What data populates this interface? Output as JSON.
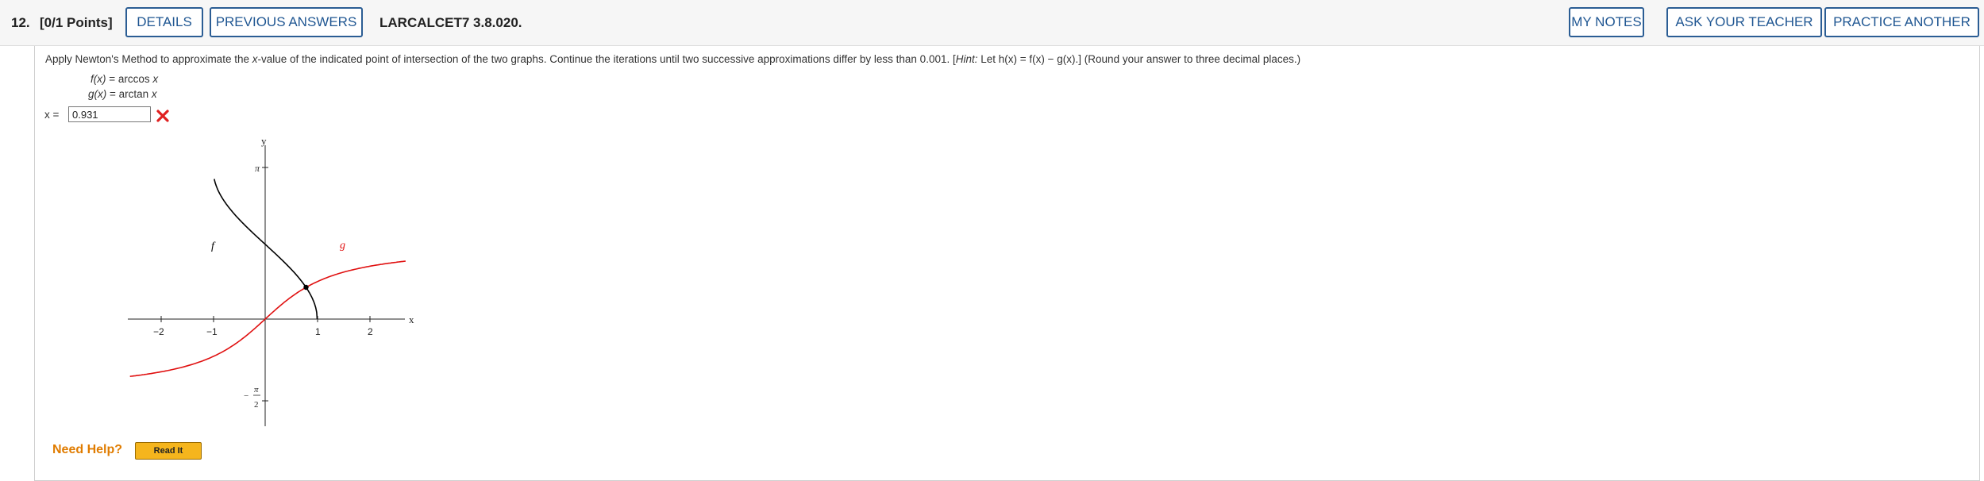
{
  "header": {
    "question_number": "12.",
    "points": "[0/1 Points]",
    "details_label": "DETAILS",
    "previous_answers_label": "PREVIOUS ANSWERS",
    "assignment_code": "LARCALCET7 3.8.020.",
    "my_notes_label": "MY NOTES",
    "ask_teacher_label": "ASK YOUR TEACHER",
    "practice_another_label": "PRACTICE ANOTHER"
  },
  "problem": {
    "text_1": "Apply Newton's Method to approximate the ",
    "var_x": "x",
    "text_2": "-value of the indicated point of intersection of the two graphs. Continue the iterations until two successive approximations differ by less than 0.001. [",
    "hint_label": "Hint:",
    "text_3": " Let ",
    "hint_formula": "h(x) = f(x) − g(x).",
    "text_4": "] (Round your answer to three decimal places.)",
    "f_lhs": "f(x)",
    "f_rhs": " = arccos ",
    "f_arg": "x",
    "g_lhs": "g(x)",
    "g_rhs": " = arctan ",
    "g_arg": "x"
  },
  "answer": {
    "label": "x =",
    "value": "0.931",
    "status": "incorrect",
    "status_icon": "red-x-icon",
    "status_color": "#e02020"
  },
  "graph": {
    "x_axis_label": "x",
    "y_axis_label": "y",
    "x_ticks": [
      "−2",
      "−1",
      "1",
      "2"
    ],
    "y_tick_top": "π",
    "y_tick_bottom_num": "π",
    "y_tick_bottom_den": "2",
    "y_tick_bottom_sign": "−",
    "f_label": "f",
    "g_label": "g",
    "f_color": "#000000",
    "g_color": "#e01010"
  },
  "help": {
    "need_help_label": "Need Help?",
    "read_it_label": "Read It"
  }
}
